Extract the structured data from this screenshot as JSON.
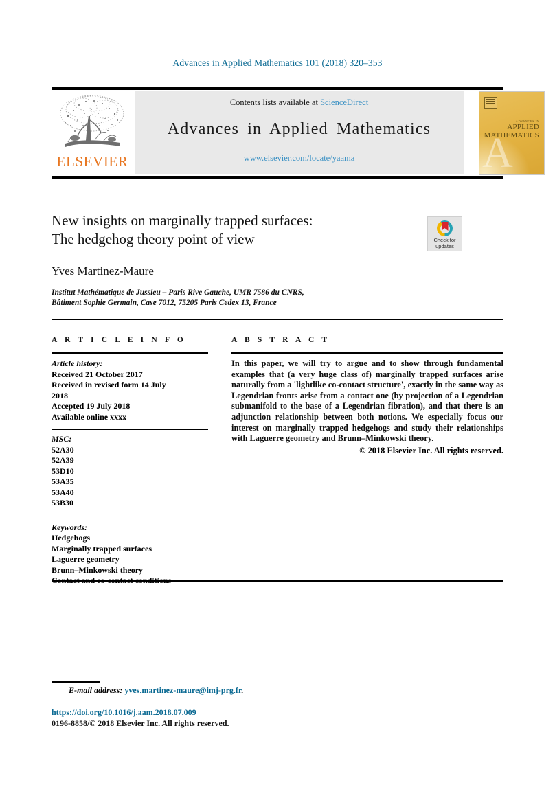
{
  "running_head": "Advances in Applied Mathematics 101 (2018) 320–353",
  "masthead": {
    "contents_prefix": "Contents lists available at ",
    "sciencedirect_link": "ScienceDirect",
    "journal_title": "Advances in Applied Mathematics",
    "journal_url": "www.elsevier.com/locate/yaama",
    "publisher_wordmark": "ELSEVIER",
    "cover": {
      "line_small": "ADVANCES IN",
      "line_main_1": "APPLIED",
      "line_main_2": "MATHEMATICS",
      "watermark_letter": "A",
      "background_color": "#E7BC52"
    }
  },
  "article": {
    "title_line_1": "New insights on marginally trapped surfaces:",
    "title_line_2": "The hedgehog theory point of view",
    "author": "Yves Martinez-Maure",
    "affiliation_line_1": "Institut Mathématique de Jussieu – Paris Rive Gauche, UMR 7586 du CNRS,",
    "affiliation_line_2": "Bâtiment Sophie Germain, Case 7012, 75205 Paris Cedex 13, France"
  },
  "crossmark": {
    "label_line_1": "Check for",
    "label_line_2": "updates"
  },
  "article_info": {
    "heading": "A R T I C L E   I N F O",
    "history_label": "Article history:",
    "history": [
      "Received 21 October 2017",
      "Received in revised form 14 July",
      "2018",
      "Accepted 19 July 2018",
      "Available online xxxx"
    ],
    "msc_label": "MSC:",
    "msc": [
      "52A30",
      "52A39",
      "53D10",
      "53A35",
      "53A40",
      "53B30"
    ],
    "keywords_label": "Keywords:",
    "keywords": [
      "Hedgehogs",
      "Marginally trapped surfaces",
      "Laguerre geometry",
      "Brunn–Minkowski theory",
      "Contact and co-contact conditions"
    ]
  },
  "abstract": {
    "heading": "A B S T R A C T",
    "body": "In this paper, we will try to argue and to show through fundamental examples that (a very huge class of) marginally trapped surfaces arise naturally from a 'lightlike co-contact structure', exactly in the same way as Legendrian fronts arise from a contact one (by projection of a Legendrian submanifold to the base of a Legendrian fibration), and that there is an adjunction relationship between both notions. We especially focus our interest on marginally trapped hedgehogs and study their relationships with Laguerre geometry and Brunn–Minkowski theory.",
    "copyright": "© 2018 Elsevier Inc. All rights reserved."
  },
  "footer": {
    "email_label": "E-mail address:",
    "email_address": "yves.martinez-maure@imj-prg.fr",
    "email_trailing": ".",
    "doi": "https://doi.org/10.1016/j.aam.2018.07.009",
    "issn_copyright": "0196-8858/© 2018 Elsevier Inc. All rights reserved."
  },
  "colors": {
    "link_blue": "#0b6a93",
    "sciencedirect_blue": "#3d92c4",
    "elsevier_orange": "#E87722",
    "cover_amber": "#E7BC52",
    "crossmark_red": "#d8262c",
    "crossmark_yellow": "#f2b600",
    "crossmark_teal": "#27a3b5"
  }
}
